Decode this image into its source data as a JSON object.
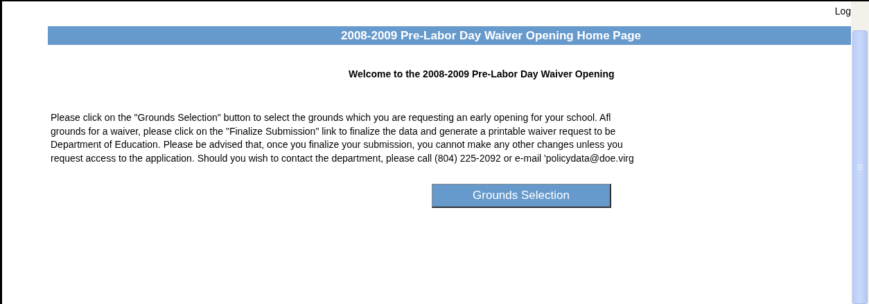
{
  "top_link": "Log",
  "header": {
    "title": "2008-2009 Pre-Labor Day Waiver Opening Home Page"
  },
  "welcome": "Welcome to the 2008-2009 Pre-Labor Day Waiver Opening",
  "instructions": [
    "Please click on the \"Grounds Selection\" button to select the grounds which you are requesting an early opening for your school. Afl",
    "grounds for a waiver, please click on the \"Finalize Submission\" link to finalize the data and generate a printable waiver request to be",
    "Department of Education. Please be advised that, once you finalize your submission, you cannot make any other changes unless you",
    "request access to the application. Should you wish to contact the department, please call (804) 225-2092 or e-mail 'policydata@doe.virg"
  ],
  "button": "Grounds Selection"
}
